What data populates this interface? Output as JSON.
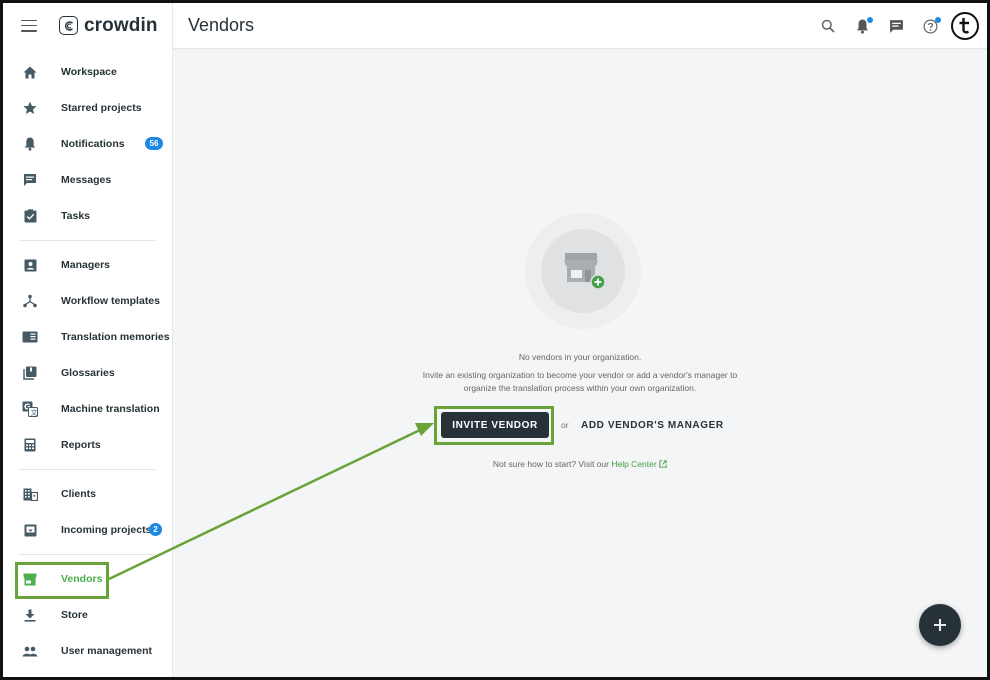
{
  "app": {
    "logo_text": "crowdin",
    "page_title": "Vendors"
  },
  "sidebar": {
    "items": [
      {
        "label": "Workspace",
        "icon": "home-icon"
      },
      {
        "label": "Starred projects",
        "icon": "star-icon"
      },
      {
        "label": "Notifications",
        "icon": "bell-icon",
        "badge": "56"
      },
      {
        "label": "Messages",
        "icon": "message-icon"
      },
      {
        "label": "Tasks",
        "icon": "task-icon"
      },
      {
        "label": "Managers",
        "icon": "manager-icon"
      },
      {
        "label": "Workflow templates",
        "icon": "workflow-icon"
      },
      {
        "label": "Translation memories",
        "icon": "translation-memory-icon"
      },
      {
        "label": "Glossaries",
        "icon": "glossary-icon"
      },
      {
        "label": "Machine translation",
        "icon": "machine-translation-icon"
      },
      {
        "label": "Reports",
        "icon": "calculator-icon"
      },
      {
        "label": "Clients",
        "icon": "building-icon"
      },
      {
        "label": "Incoming projects",
        "icon": "inbox-icon",
        "badge": "2"
      },
      {
        "label": "Vendors",
        "icon": "store-icon",
        "active": true
      },
      {
        "label": "Store",
        "icon": "download-icon"
      },
      {
        "label": "User management",
        "icon": "users-icon"
      }
    ]
  },
  "main": {
    "empty_title": "No vendors in your organization.",
    "empty_description": "Invite an existing organization to become your vendor or add a vendor's manager to organize the translation process within your own organization.",
    "invite_button": "INVITE VENDOR",
    "or_text": "or",
    "add_manager_button": "ADD VENDOR'S MANAGER",
    "help_prefix": "Not sure how to start? Visit our",
    "help_link": "Help Center"
  },
  "colors": {
    "accent_green": "#4caf50",
    "badge_blue": "#1e88e5",
    "dark": "#263238",
    "annotation_green": "#6aa339"
  }
}
